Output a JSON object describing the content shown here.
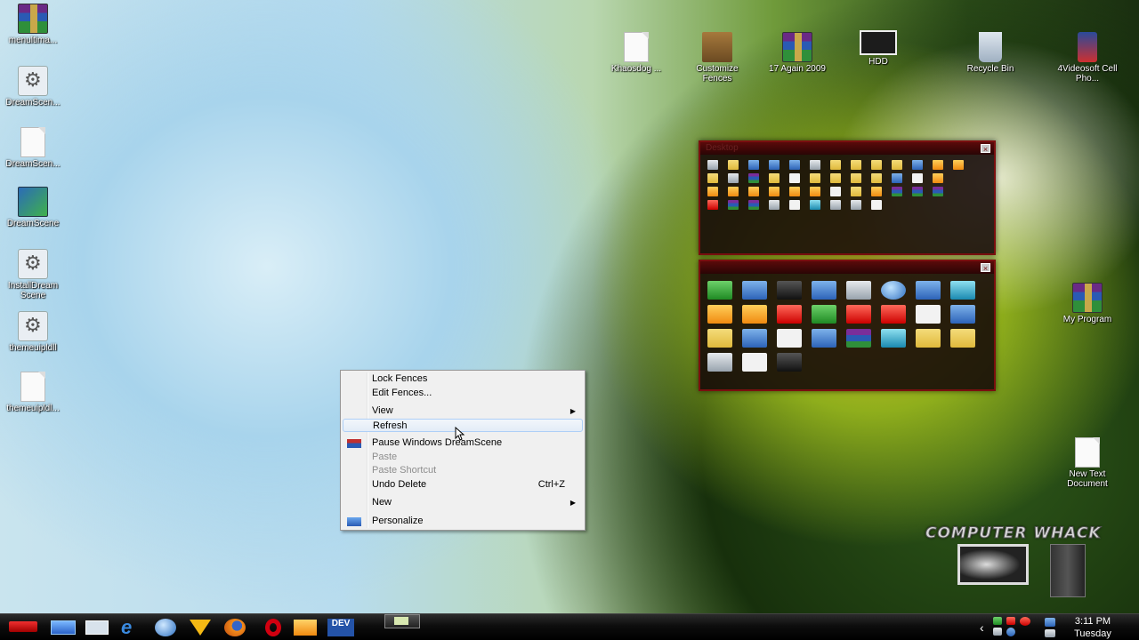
{
  "desktop_icons_left": [
    {
      "label": "menultima...",
      "kind": "rar"
    },
    {
      "label": "DreamScen...",
      "kind": "gear"
    },
    {
      "label": "DreamScen...",
      "kind": "doc"
    },
    {
      "label": "DreamScene",
      "kind": "install"
    },
    {
      "label": "InstallDream Scene",
      "kind": "gear"
    },
    {
      "label": "themeuipldll",
      "kind": "gear"
    },
    {
      "label": "themeuipldl...",
      "kind": "doc"
    }
  ],
  "desktop_icons_top": [
    {
      "label": "Khaosdog ...",
      "kind": "doc"
    },
    {
      "label": "Customize Fences",
      "kind": "fences"
    },
    {
      "label": "17 Again 2009",
      "kind": "rar"
    },
    {
      "label": "HDD",
      "kind": "hdd"
    },
    {
      "label": "Recycle Bin",
      "kind": "bin"
    },
    {
      "label": "4Videosoft Cell Pho...",
      "kind": "phone"
    }
  ],
  "desktop_icons_right": [
    {
      "label": "My Program",
      "kind": "rar"
    },
    {
      "label": "New Text Document",
      "kind": "doc"
    }
  ],
  "fence_desktop": {
    "title": "Desktop",
    "close": "×",
    "icons": [
      "gray",
      "folder",
      "blue",
      "blue",
      "blue",
      "gray",
      "folder",
      "folder",
      "folder",
      "folder",
      "blue",
      "orange",
      "orange",
      "folder",
      "gray",
      "rar",
      "folder",
      "white",
      "folder",
      "folder",
      "folder",
      "folder",
      "blue",
      "white",
      "orange",
      "",
      "orange",
      "orange",
      "orange",
      "orange",
      "orange",
      "orange",
      "white",
      "folder",
      "orange",
      "rar",
      "rar",
      "rar",
      "",
      "red",
      "rar",
      "rar",
      "gray",
      "white",
      "teal",
      "gray",
      "gray",
      "white",
      "",
      "",
      "",
      "",
      ""
    ]
  },
  "fence_programs": {
    "title": "",
    "close": "×",
    "icons": [
      "green",
      "blue",
      "dark",
      "blue",
      "gray",
      "earth",
      "blue",
      "teal",
      "orange",
      "orange",
      "red",
      "green",
      "red",
      "red",
      "white",
      "blue",
      "folder",
      "blue",
      "white",
      "blue",
      "rar",
      "teal",
      "folder",
      "folder",
      "gray",
      "white",
      "dark"
    ]
  },
  "context_menu": {
    "items": [
      {
        "label": "Lock Fences",
        "disabled": false
      },
      {
        "label": "Edit Fences...",
        "disabled": false
      },
      {
        "sep": true
      },
      {
        "label": "View",
        "submenu": true
      },
      {
        "label": "Refresh",
        "hover": true
      },
      {
        "sep": true
      },
      {
        "label": "Pause Windows DreamScene",
        "icon": "dreamscene-icon"
      },
      {
        "label": "Paste",
        "disabled": true
      },
      {
        "label": "Paste Shortcut",
        "disabled": true
      },
      {
        "label": "Undo Delete",
        "shortcut": "Ctrl+Z"
      },
      {
        "sep": true
      },
      {
        "label": "New",
        "submenu": true
      },
      {
        "sep": true
      },
      {
        "label": "Personalize",
        "icon": "personalize-icon"
      }
    ]
  },
  "taskbar": {
    "pinned": [
      "show-desktop-icon",
      "explorer-icon",
      "ie-icon",
      "thunderbird-icon",
      "pizza-icon",
      "firefox-icon",
      "opera-icon",
      "media-player-icon",
      "devexpress-icon"
    ],
    "devexpress_label": "DEV",
    "clock_time": "3:11 PM",
    "clock_day": "Tuesday",
    "tray_expand": "‹"
  },
  "branding_text": "COMPUTER WHACK",
  "colors": {
    "fence_border": "#7a0f0f",
    "menu_bg": "#f0f0f0",
    "hover_border": "#aecff7"
  }
}
